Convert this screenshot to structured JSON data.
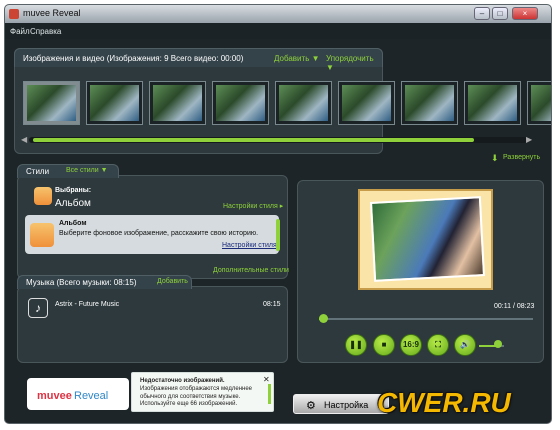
{
  "window": {
    "title": "muvee Reveal"
  },
  "menu": [
    "Файл",
    "Справка"
  ],
  "media": {
    "header": "Изображения и видео (Изображения: 9 Всего видео: 00:00)",
    "add": "Добавить ▼",
    "sort": "Упорядочить ▼",
    "expand": "Развернуть",
    "thumbnail_count": 9,
    "scroll_progress": 0.9
  },
  "styles": {
    "header": "Стили",
    "all": "Все стили ▼",
    "selected_label": "Выбраны:",
    "selected_name": "Альбом",
    "settings": "Настройки стиля ▸",
    "album_title": "Альбом",
    "album_desc": "Выберите фоновое изображение, расскажите свою историю.",
    "album_settings": "Настройки стиля",
    "more": "Дополнительные стили"
  },
  "music": {
    "header": "Музыка (Всего музыки: 08:15)",
    "add": "Добавить",
    "track": "Astrix - Future Music",
    "duration": "08:15"
  },
  "preview": {
    "time": "00:11 / 08:23",
    "progress": 0.02,
    "aspect": "16:9",
    "volume": 0.75
  },
  "notice": {
    "title": "Недостаточно изображений.",
    "text": "Изображения отображаются медленнее обычного для соответствия музыке. Используйте еще 66 изображений."
  },
  "buttons": {
    "settings": "Настройка"
  },
  "watermark": "CWER.RU",
  "logo": {
    "muvee": "muvee",
    "reveal": "Reveal"
  }
}
